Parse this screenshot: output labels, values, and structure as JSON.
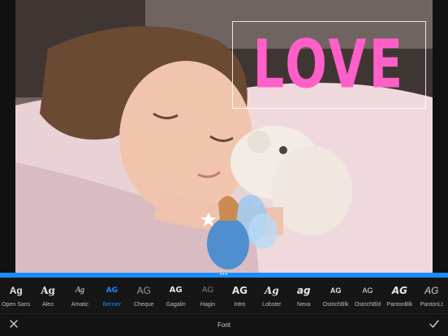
{
  "canvas": {
    "overlay_text": "LOVE",
    "overlay_color": "#ff5fc8"
  },
  "fonts": [
    {
      "name": "Open Sans",
      "sample": "Ag"
    },
    {
      "name": "Aleo",
      "sample": "Ag"
    },
    {
      "name": "Amatic",
      "sample": "Ag"
    },
    {
      "name": "Bernier",
      "sample": "AG"
    },
    {
      "name": "Cheque",
      "sample": "AG"
    },
    {
      "name": "Gagalin",
      "sample": "AG"
    },
    {
      "name": "Hagin",
      "sample": "AG"
    },
    {
      "name": "Intro",
      "sample": "AG"
    },
    {
      "name": "Lobster",
      "sample": "Ag"
    },
    {
      "name": "Nexa",
      "sample": "ag"
    },
    {
      "name": "OstrichBlk",
      "sample": "AG"
    },
    {
      "name": "OstrichBld",
      "sample": "AG"
    },
    {
      "name": "PantonBlk",
      "sample": "AG"
    },
    {
      "name": "PantonLt",
      "sample": "AG"
    }
  ],
  "selected_font": "Bernier",
  "bottom_bar": {
    "title": "Font",
    "close_icon": "close-icon",
    "confirm_icon": "checkmark-icon"
  },
  "colors": {
    "accent": "#1a8cff",
    "toolbar_bg": "#161616"
  }
}
